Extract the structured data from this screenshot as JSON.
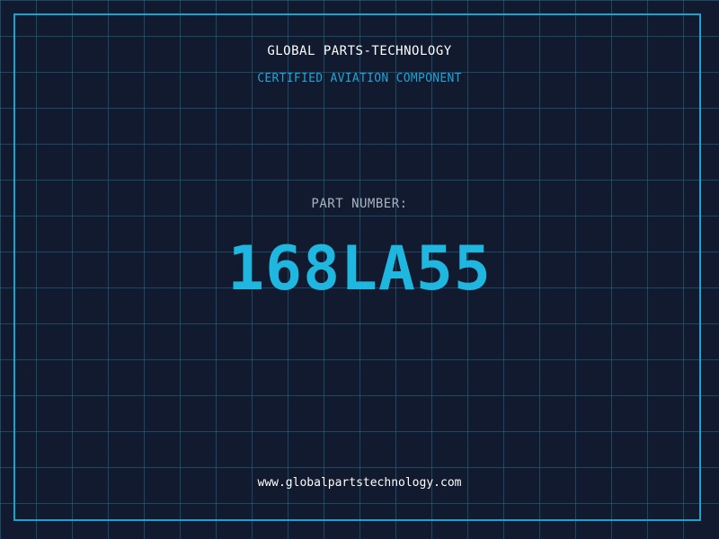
{
  "header": {
    "company_name": "GLOBAL PARTS-TECHNOLOGY",
    "tagline": "CERTIFIED AVIATION COMPONENT"
  },
  "part": {
    "label": "PART NUMBER:",
    "number": "168LA55"
  },
  "footer": {
    "website": "www.globalpartstechnology.com"
  },
  "colors": {
    "background": "#111a2e",
    "grid": "#266e8c",
    "frame": "#1aa3cf",
    "accent": "#1fb7df"
  }
}
